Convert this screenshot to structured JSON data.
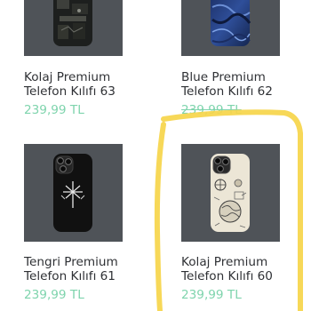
{
  "products": [
    {
      "title_line1": "Kolaj Premium",
      "title_line2": "Telefon Kılıfı 63",
      "price": "239,99 TL",
      "image_icon": "phone-case-image"
    },
    {
      "title_line1": "Blue Premium",
      "title_line2": "Telefon Kılıfı 62",
      "price": "239,99 TL",
      "image_icon": "phone-case-image"
    },
    {
      "title_line1": "Tengri Premium",
      "title_line2": "Telefon Kılıfı 61",
      "price": "239,99 TL",
      "image_icon": "phone-case-image"
    },
    {
      "title_line1": "Kolaj Premium",
      "title_line2": "Telefon Kılıfı 60",
      "price": "239,99 TL",
      "image_icon": "phone-case-image"
    }
  ],
  "colors": {
    "thumbnail_bg": "#4f5358",
    "price": "#7fd4ad",
    "title": "#2f3135",
    "highlight_stroke": "#f6d54a"
  }
}
